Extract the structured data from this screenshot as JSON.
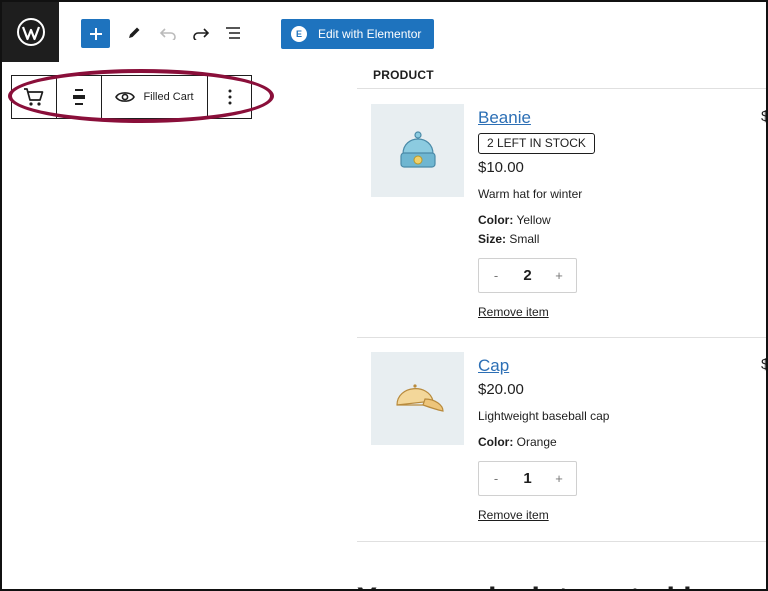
{
  "toolbar": {
    "edit_button_label": "Edit with Elementor",
    "edit_button_icon": "E"
  },
  "block_toolbar": {
    "view_label": "Filled Cart"
  },
  "cart": {
    "column_header": "PRODUCT",
    "items": [
      {
        "name": "Beanie",
        "stock": "2 LEFT IN STOCK",
        "price": "$10.00",
        "description": "Warm hat for winter",
        "attributes": [
          {
            "label": "Color:",
            "value": "Yellow"
          },
          {
            "label": "Size:",
            "value": "Small"
          }
        ],
        "quantity": "2",
        "remove_label": "Remove item",
        "clipped_price": "$"
      },
      {
        "name": "Cap",
        "price": "$20.00",
        "description": "Lightweight baseball cap",
        "attributes": [
          {
            "label": "Color:",
            "value": "Orange"
          }
        ],
        "quantity": "1",
        "remove_label": "Remove item",
        "clipped_price": "$"
      }
    ],
    "qty_minus": "-",
    "qty_plus": "+"
  },
  "bottom_heading": "You may be interested in…",
  "colors": {
    "accent": "#1e73be",
    "highlight": "#8a0f3a",
    "link": "#2c6fb5"
  }
}
